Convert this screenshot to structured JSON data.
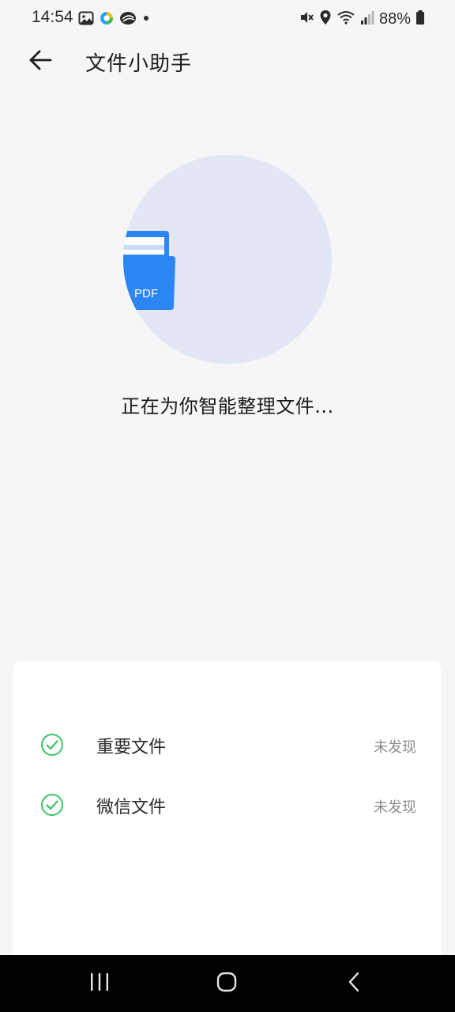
{
  "status_bar": {
    "time": "14:54",
    "battery": "88%",
    "left_icons": [
      "image-icon",
      "app-icon",
      "app-icon",
      "dot-icon"
    ],
    "right_icons": [
      "mute-icon",
      "location-icon",
      "wifi-icon",
      "signal-icon",
      "battery-icon"
    ]
  },
  "header": {
    "back_icon": "arrow-left-icon",
    "title": "文件小助手"
  },
  "illustration": {
    "file_label": "PDF",
    "circle_color": "#e3e6f4",
    "file_color": "#2b86f3"
  },
  "progress": {
    "text": "正在为你智能整理文件..."
  },
  "results": {
    "rows": [
      {
        "label": "重要文件",
        "status": "未发现",
        "icon": "check-circle-icon"
      },
      {
        "label": "微信文件",
        "status": "未发现",
        "icon": "check-circle-icon"
      }
    ],
    "check_color": "#3cc46a"
  },
  "nav_bar": {
    "buttons": [
      "recent-apps-icon",
      "home-icon",
      "back-icon"
    ]
  }
}
